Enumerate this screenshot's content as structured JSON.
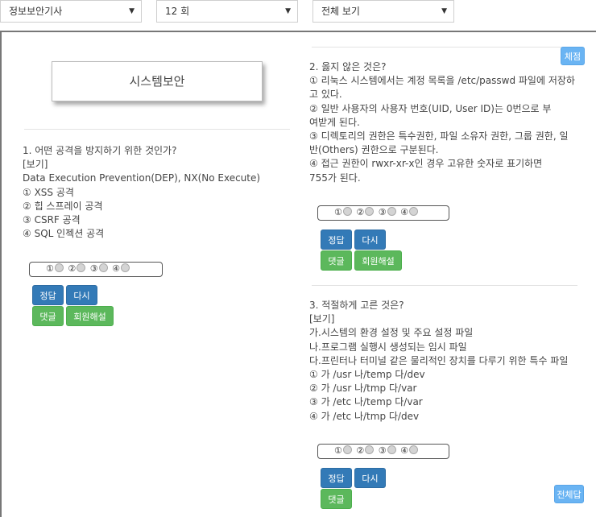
{
  "selects": [
    {
      "value": "정보보안기사"
    },
    {
      "value": "12 회"
    },
    {
      "value": "전체 보기"
    }
  ],
  "section_title": "시스템보안",
  "grade_button": "체점",
  "show_all_answers_button": "전체답",
  "questions": [
    {
      "lines": [
        "1. 어떤 공격을 방지하기 위한 것인가?",
        "[보기]",
        "Data Execution Prevention(DEP), NX(No Execute)",
        "① XSS 공격",
        "② 힙 스프레이 공격",
        "③ CSRF 공격",
        "④ SQL 인젝션 공격"
      ],
      "choices": [
        "①",
        "②",
        "③",
        "④"
      ],
      "buttons": {
        "answer": "정답",
        "retry": "다시",
        "comment": "댓글",
        "member_explain": "회원해설"
      }
    },
    {
      "lines": [
        "2. 옳지 않은 것은?",
        "① 리눅스 시스템에서는 계정 목록을 /etc/passwd 파일에 저장하",
        "고 있다.",
        "② 일반 사용자의 사용자 번호(UID, User ID)는 0번으로 부",
        "여받게 된다.",
        "③ 디렉토리의 권한은 특수권한, 파일 소유자 권한, 그룹 권한, 일",
        "반(Others) 권한으로 구분된다.",
        "④ 접근 권한이 rwxr-xr-x인 경우 고유한 숫자로 표기하면",
        "755가 된다."
      ],
      "choices": [
        "①",
        "②",
        "③",
        "④"
      ],
      "buttons": {
        "answer": "정답",
        "retry": "다시",
        "comment": "댓글",
        "member_explain": "회원해설"
      }
    },
    {
      "lines": [
        "3. 적절하게 고른 것은?",
        "[보기]",
        "가.시스템의 환경 설정 및 주요 설정 파일",
        "나.프로그램 실행시 생성되는 임시 파일",
        "다.프린터나 터미널 같은 물리적인 장치를 다루기 위한 특수 파일",
        "① 가 /usr 나/temp 다/dev",
        "② 가 /usr 나/tmp 다/var",
        "③ 가 /etc 나/temp 다/var",
        "④ 가 /etc 나/tmp 다/dev"
      ],
      "choices": [
        "①",
        "②",
        "③",
        "④"
      ],
      "buttons": {
        "answer": "정답",
        "retry": "다시",
        "comment": "댓글"
      }
    }
  ]
}
